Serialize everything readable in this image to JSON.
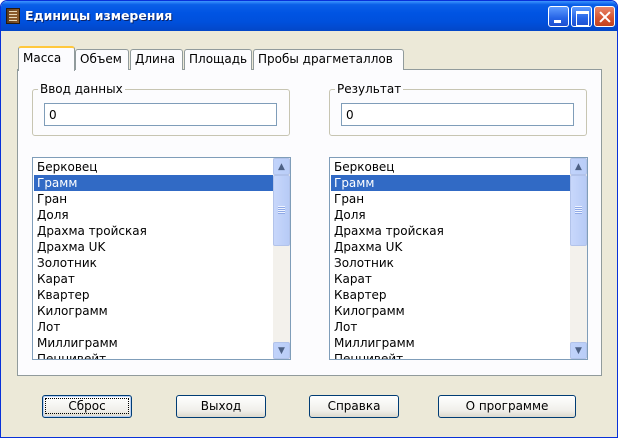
{
  "window": {
    "title": "Единицы измерения"
  },
  "tabs": [
    {
      "label": "Масса"
    },
    {
      "label": "Объем"
    },
    {
      "label": "Длина"
    },
    {
      "label": "Площадь"
    },
    {
      "label": "Пробы драгметаллов"
    }
  ],
  "input_group": {
    "label": "Ввод данных",
    "value": "0"
  },
  "result_group": {
    "label": "Результат",
    "value": "0"
  },
  "left_list": {
    "selected_index": 1,
    "items": [
      "Берковец",
      "Грамм",
      "Гран",
      "Доля",
      "Драхма тройская",
      "Драхма UK",
      "Золотник",
      "Карат",
      "Квартер",
      "Килограмм",
      "Лот",
      "Миллиграмм",
      "Пеннивейт"
    ]
  },
  "right_list": {
    "selected_index": 1,
    "items": [
      "Берковец",
      "Грамм",
      "Гран",
      "Доля",
      "Драхма тройская",
      "Драхма UK",
      "Золотник",
      "Карат",
      "Квартер",
      "Килограмм",
      "Лот",
      "Миллиграмм",
      "Пеннивейт"
    ]
  },
  "buttons": {
    "reset": "Сброс",
    "exit": "Выход",
    "help": "Справка",
    "about": "О программе"
  },
  "colors": {
    "titlebar": "#0054E3",
    "selection": "#316AC5",
    "window_bg": "#ECE9D8",
    "tab_accent": "#FFC83C"
  },
  "icons": {
    "app": "abacus-icon",
    "minimize": "minimize-icon",
    "maximize": "maximize-icon",
    "close": "close-icon",
    "scroll_up": "chevron-up-icon",
    "scroll_down": "chevron-down-icon"
  }
}
